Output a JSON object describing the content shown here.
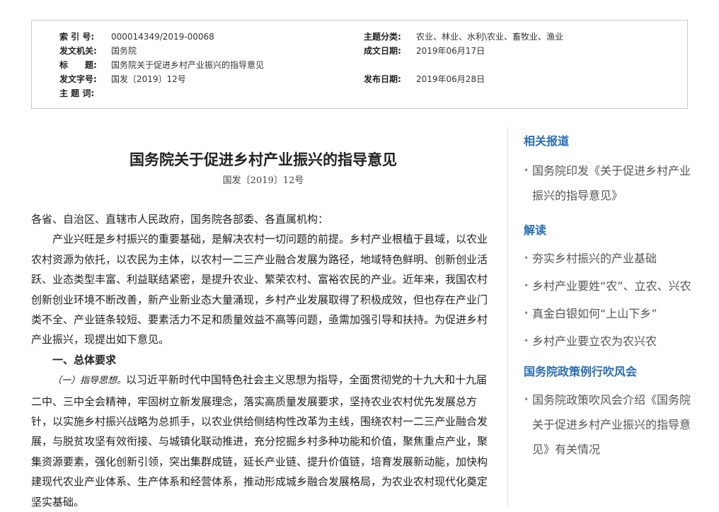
{
  "meta": {
    "index_label": "索 引 号:",
    "index_value": "000014349/2019-00068",
    "topic_label": "主题分类:",
    "topic_value": "农业、林业、水利\\农业、畜牧业、渔业",
    "issuer_label": "发文机关:",
    "issuer_value": "国务院",
    "written_label": "成文日期:",
    "written_value": "2019年06月17日",
    "title_label": "标　　题:",
    "title_value": "国务院关于促进乡村产业振兴的指导意见",
    "docno_label": "发文字号:",
    "docno_value": "国发〔2019〕12号",
    "published_label": "发布日期:",
    "published_value": "2019年06月28日",
    "keywords_label": "主 题 词:",
    "keywords_value": ""
  },
  "document": {
    "title": "国务院关于促进乡村产业振兴的指导意见",
    "number": "国发〔2019〕12号",
    "salutation": "各省、自治区、直辖市人民政府，国务院各部委、各直属机构：",
    "para1": "产业兴旺是乡村振兴的重要基础，是解决农村一切问题的前提。乡村产业根植于县域，以农业农村资源为依托，以农民为主体，以农村一二三产业融合发展为路径，地域特色鲜明、创新创业活跃、业态类型丰富、利益联结紧密，是提升农业、繁荣农村、富裕农民的产业。近年来，我国农村创新创业环境不断改善，新产业新业态大量涌现，乡村产业发展取得了积极成效，但也存在产业门类不全、产业链条较短、要素活力不足和质量效益不高等问题，亟需加强引导和扶持。为促进乡村产业振兴，现提出如下意见。",
    "section1": "一、总体要求",
    "sub1_label": "（一）指导思想。",
    "sub1_text": "以习近平新时代中国特色社会主义思想为指导，全面贯彻党的十九大和十九届二中、三中全会精神，牢固树立新发展理念，落实高质量发展要求，坚持农业农村优先发展总方针，以实施乡村振兴战略为总抓手，以农业供给侧结构性改革为主线，围绕农村一二三产业融合发展，与脱贫攻坚有效衔接、与城镇化联动推进，充分挖掘乡村多种功能和价值，聚焦重点产业，聚集资源要素，强化创新引领，突出集群成链，延长产业链、提升价值链，培育发展新动能，加快构建现代农业产业体系、生产体系和经营体系，推动形成城乡融合发展格局，为农业农村现代化奠定坚实基础。"
  },
  "sidebar": {
    "related_heading": "相关报道",
    "related_items": [
      "国务院印发《关于促进乡村产业振兴的指导意见》"
    ],
    "interpret_heading": "解读",
    "interpret_items": [
      "夯实乡村振兴的产业基础",
      "乡村产业要姓“农”、立农、兴农",
      "真金白银如何“上山下乡”",
      "乡村产业要立农为农兴农"
    ],
    "briefing_heading": "国务院政策例行吹风会",
    "briefing_items": [
      "国务院政策吹风会介绍《国务院关于促进乡村产业振兴的指导意见》有关情况"
    ],
    "accent_color": "#2a6db5"
  }
}
